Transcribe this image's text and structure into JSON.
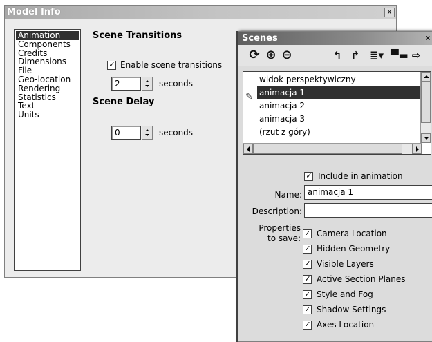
{
  "model_info": {
    "title": "Model Info",
    "close_label": "x",
    "categories": [
      "Animation",
      "Components",
      "Credits",
      "Dimensions",
      "File",
      "Geo-location",
      "Rendering",
      "Statistics",
      "Text",
      "Units"
    ],
    "selected_category": "Animation",
    "scene_transitions": {
      "heading": "Scene Transitions",
      "enable_label": "Enable scene transitions",
      "enabled": true,
      "seconds_value": "2",
      "seconds_unit": "seconds"
    },
    "scene_delay": {
      "heading": "Scene Delay",
      "seconds_value": "0",
      "seconds_unit": "seconds"
    }
  },
  "scenes": {
    "title": "Scenes",
    "close_label": "x",
    "toolbar_icons": [
      "refresh-icon",
      "add-icon",
      "remove-icon",
      "move-up-icon",
      "move-down-icon",
      "view-options-icon",
      "details-icon",
      "export-icon"
    ],
    "items": [
      {
        "label": "widok perspektywiczny",
        "selected": false
      },
      {
        "label": "animacja 1",
        "selected": true
      },
      {
        "label": "animacja 2",
        "selected": false
      },
      {
        "label": "animacja 3",
        "selected": false
      },
      {
        "label": "(rzut z góry)",
        "selected": false
      }
    ],
    "include_label": "Include in animation",
    "include_checked": true,
    "name_label": "Name:",
    "name_value": "animacja 1",
    "description_label": "Description:",
    "description_value": "",
    "properties_label_line1": "Properties",
    "properties_label_line2": "to save:",
    "properties": [
      {
        "label": "Camera Location",
        "checked": true
      },
      {
        "label": "Hidden Geometry",
        "checked": true
      },
      {
        "label": "Visible Layers",
        "checked": true
      },
      {
        "label": "Active Section Planes",
        "checked": true
      },
      {
        "label": "Style and Fog",
        "checked": true
      },
      {
        "label": "Shadow Settings",
        "checked": true
      },
      {
        "label": "Axes Location",
        "checked": true
      }
    ]
  }
}
